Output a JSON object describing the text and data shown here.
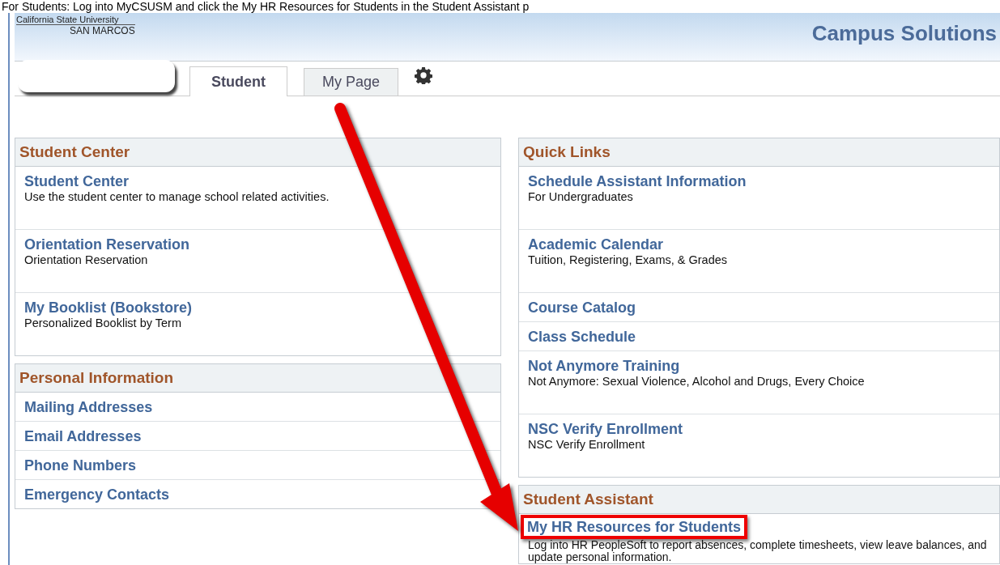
{
  "caption": "For Students: Log into MyCSUSM and click the My HR Resources for Students in the Student Assistant p",
  "header": {
    "logo_line_1": "California State University",
    "logo_line_2": "SAN MARCOS",
    "title": "Campus Solutions"
  },
  "tabs": [
    {
      "label": "Student",
      "selected": true
    },
    {
      "label": "My Page",
      "selected": false
    }
  ],
  "left_panels": [
    {
      "title": "Student Center",
      "items": [
        {
          "link": "Student Center",
          "description": "Use the student center to manage school related activities."
        },
        {
          "link": "Orientation Reservation",
          "description": "Orientation Reservation"
        },
        {
          "link": "My Booklist (Bookstore)",
          "description": "Personalized Booklist by Term"
        }
      ]
    },
    {
      "title": "Personal Information",
      "items": [
        {
          "link": "Mailing Addresses"
        },
        {
          "link": "Email Addresses"
        },
        {
          "link": "Phone Numbers"
        },
        {
          "link": "Emergency Contacts"
        }
      ]
    }
  ],
  "right_panels": [
    {
      "title": "Quick Links",
      "items": [
        {
          "link": "Schedule Assistant Information",
          "description": "For Undergraduates"
        },
        {
          "link": "Academic Calendar",
          "description": "Tuition, Registering, Exams, & Grades"
        },
        {
          "link": "Course Catalog"
        },
        {
          "link": "Class Schedule"
        },
        {
          "link": "Not Anymore Training",
          "description": "Not Anymore: Sexual Violence, Alcohol and Drugs, Every Choice"
        },
        {
          "link": "NSC Verify Enrollment",
          "description": "NSC Verify Enrollment"
        }
      ]
    },
    {
      "title": "Student Assistant",
      "items": [
        {
          "link": "My HR Resources for Students",
          "highlighted": true,
          "description": "Log into HR PeopleSoft to report absences, complete timesheets, view leave balances, and update personal information."
        }
      ]
    }
  ]
}
